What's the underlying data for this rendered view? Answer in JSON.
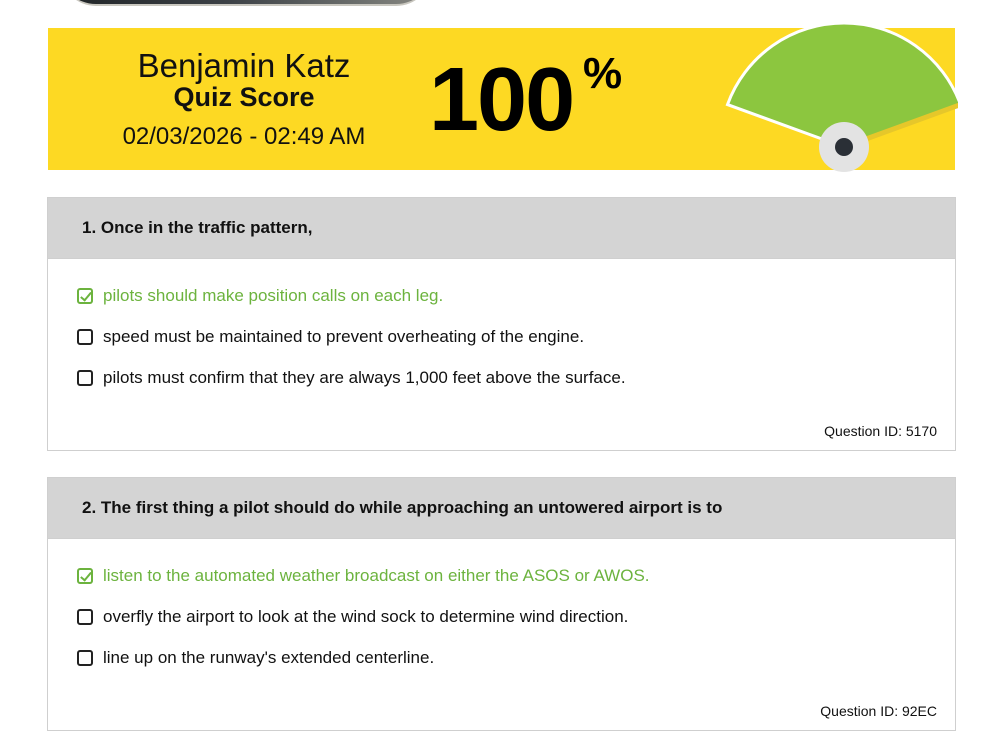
{
  "banner": {
    "student_name": "Benjamin Katz",
    "label": "Quiz Score",
    "date": "02/03/2026 - 02:49 AM",
    "score": "100",
    "percent_sign": "%",
    "score_fraction": 1.0,
    "colors": {
      "banner": "#fdd923",
      "gauge_fill": "#8cc63f",
      "needle": "#e6c72a"
    }
  },
  "questions": [
    {
      "title": "1. Once in the traffic pattern,",
      "answers": [
        {
          "text": "pilots should make position calls on each leg.",
          "correct": true,
          "checked": true
        },
        {
          "text": "speed must be maintained to prevent overheating of the engine.",
          "correct": false,
          "checked": false
        },
        {
          "text": "pilots must confirm that they are always 1,000 feet above the surface.",
          "correct": false,
          "checked": false
        }
      ],
      "question_id": "Question ID: 5170"
    },
    {
      "title": "2. The first thing a pilot should do while approaching an untowered airport is to",
      "answers": [
        {
          "text": "listen to the automated weather broadcast on either the ASOS or AWOS.",
          "correct": true,
          "checked": true
        },
        {
          "text": "overfly the airport to look at the wind sock to determine wind direction.",
          "correct": false,
          "checked": false
        },
        {
          "text": "line up on the runway's extended centerline.",
          "correct": false,
          "checked": false
        }
      ],
      "question_id": "Question ID: 92EC"
    }
  ]
}
